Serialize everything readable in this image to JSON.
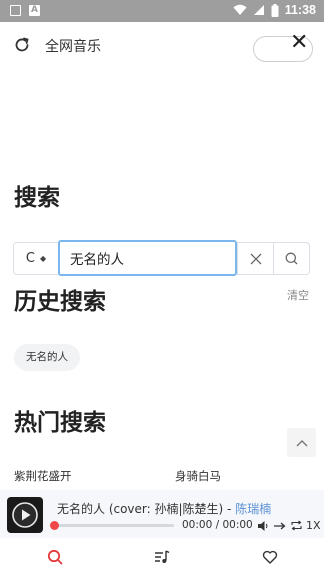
{
  "status_bar": {
    "time": "11:38"
  },
  "header": {
    "title": "全网音乐"
  },
  "search": {
    "heading": "搜索",
    "engine": "C",
    "query": "无名的人"
  },
  "history": {
    "heading": "历史搜索",
    "clear_label": "清空",
    "items": [
      "无名的人"
    ]
  },
  "hot": {
    "heading": "热门搜索",
    "items": [
      "紫荆花盛开",
      "身骑白马"
    ]
  },
  "player": {
    "title": "无名的人 (cover: 孙楠|陈楚生)",
    "separator": " - ",
    "artist": "陈瑞楠",
    "time": "00:00 / 00:00",
    "speed": "1X",
    "progress": 0
  },
  "colors": {
    "accent": "#f04848",
    "input_focus": "#7cb6ef",
    "artist_link": "#5b8fd6",
    "status_bar": "#9e9e9e"
  }
}
